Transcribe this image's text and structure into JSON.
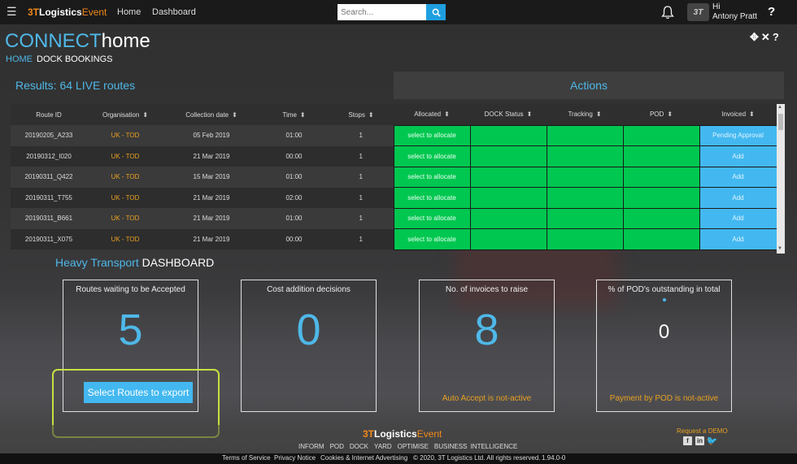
{
  "header": {
    "logo_3t": "3T",
    "logo_logistics": "Logistics",
    "logo_event": "Event",
    "nav": [
      "Home",
      "Dashboard"
    ],
    "search_placeholder": "Search...",
    "greeting": "Hi",
    "user_name": "Antony Pratt",
    "avatar_text": "3T",
    "help": "?"
  },
  "page": {
    "title_connect": "CONNECT",
    "title_home": "home",
    "breadcrumb_home": "HOME",
    "breadcrumb_current": "DOCK BOOKINGS",
    "results": "Results: 64 LIVE routes",
    "actions_title": "Actions"
  },
  "table": {
    "columns": [
      "Route ID",
      "Organisation",
      "Collection date",
      "Time",
      "Stops",
      "Allocated",
      "DOCK Status",
      "Tracking",
      "POD",
      "Invoiced"
    ],
    "rows": [
      {
        "route_id": "20190205_A233",
        "org": "UK - TOD",
        "date": "05 Feb 2019",
        "time": "01:00",
        "stops": "1",
        "allocated": "select to allocate",
        "invoiced": "Pending Approval"
      },
      {
        "route_id": "20190312_I020",
        "org": "UK - TOD",
        "date": "21 Mar 2019",
        "time": "00:00",
        "stops": "1",
        "allocated": "select to allocate",
        "invoiced": "Add"
      },
      {
        "route_id": "20190311_Q422",
        "org": "UK - TOD",
        "date": "15 Mar 2019",
        "time": "01:00",
        "stops": "1",
        "allocated": "select to allocate",
        "invoiced": "Add"
      },
      {
        "route_id": "20190311_T755",
        "org": "UK - TOD",
        "date": "21 Mar 2019",
        "time": "02:00",
        "stops": "1",
        "allocated": "select to allocate",
        "invoiced": "Add"
      },
      {
        "route_id": "20190311_B661",
        "org": "UK - TOD",
        "date": "21 Mar 2019",
        "time": "01:00",
        "stops": "1",
        "allocated": "select to allocate",
        "invoiced": "Add"
      },
      {
        "route_id": "20190311_X075",
        "org": "UK - TOD",
        "date": "21 Mar 2019",
        "time": "00:00",
        "stops": "1",
        "allocated": "select to allocate",
        "invoiced": "Add"
      }
    ]
  },
  "dashboard": {
    "title_a": "Heavy Transport",
    "title_b": "DASHBOARD",
    "cards": [
      {
        "label": "Routes waiting to be Accepted",
        "value": "5",
        "button": "Select Routes to export"
      },
      {
        "label": "Cost addition decisions",
        "value": "0"
      },
      {
        "label": "No. of invoices to raise",
        "value": "8",
        "note": "Auto Accept is not-active"
      },
      {
        "label": "% of POD's outstanding in total",
        "value": "0",
        "note": "Payment by POD is not-active"
      }
    ]
  },
  "footer": {
    "nav": [
      "INFORM",
      "POD",
      "DOCK",
      "YARD",
      "OPTIMISE",
      "BUSINESS INTELLIGENCE"
    ],
    "demo": "Request a DEMO",
    "social": [
      "f",
      "in"
    ],
    "links": [
      "Terms of Service",
      "Privacy Notice",
      "Cookies & Internet Advertising",
      "© 2020, 3T Logistics Ltd. All rights reserved.",
      "1.94.0-0"
    ]
  },
  "colors": {
    "accent": "#4fb8e8",
    "green": "#00c750",
    "orange": "#e8a020",
    "highlight": "#c8e040"
  }
}
